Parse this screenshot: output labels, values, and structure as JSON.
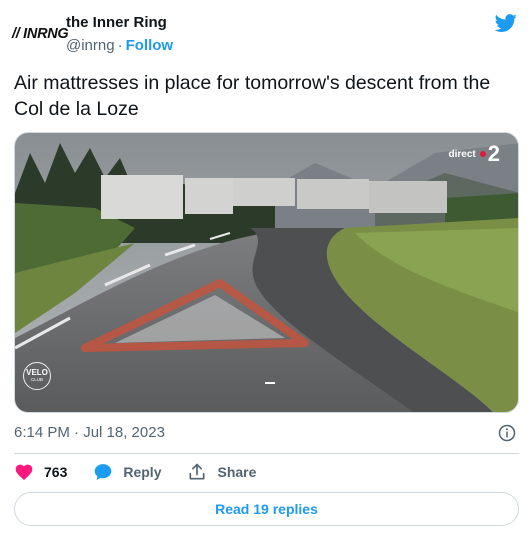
{
  "author": {
    "avatar_text": "// INRNG",
    "name": "the Inner Ring",
    "handle": "@inrng",
    "separator": "·",
    "follow_label": "Follow"
  },
  "tweet": {
    "text": "Air mattresses in place for tomorrow's descent from the Col de la Loze",
    "timestamp": "6:14 PM · Jul 18, 2023"
  },
  "media": {
    "velo_line1": "VELO",
    "velo_line2": "CLUB",
    "channel_live": "direct",
    "channel_number": "2"
  },
  "actions": {
    "like_count": "763",
    "reply_label": "Reply",
    "share_label": "Share"
  },
  "replies_button": "Read 19 replies",
  "colors": {
    "twitter_blue": "#1d9bf0",
    "like_pink": "#f91880",
    "text_dark": "#0f1419",
    "text_grey": "#536471"
  }
}
